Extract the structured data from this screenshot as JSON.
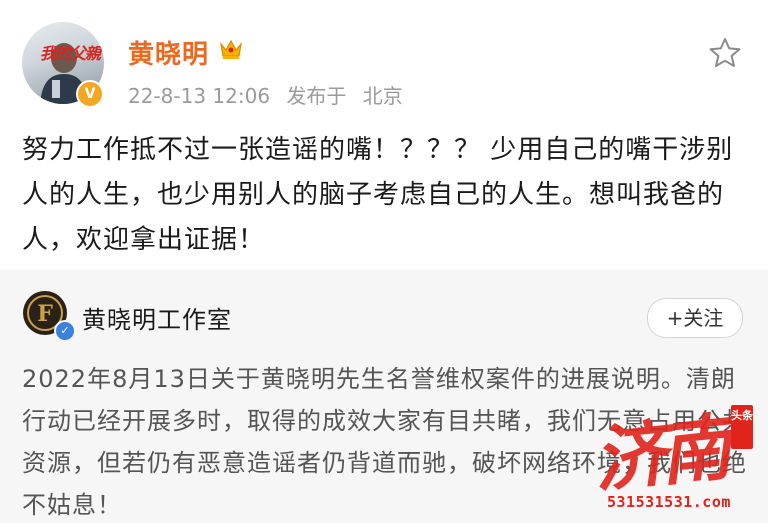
{
  "post": {
    "avatar_caption": "我的父親",
    "author_name": "黄晓明",
    "timestamp": "22-8-13 12:06",
    "location_prefix": "发布于",
    "location": "北京",
    "content": "努力工作抵不过一张造谣的嘴！？？？ 少用自己的嘴干涉别人的人生，也少用别人的脑子考虑自己的人生。想叫我爸的人，欢迎拿出证据！",
    "icons": {
      "verified": "verified-badge-icon",
      "crown": "crown-icon",
      "favorite": "star-icon"
    },
    "colors": {
      "author": "#ea6a1f",
      "meta": "#9a9a9a",
      "badge": "#f5a623"
    }
  },
  "repost": {
    "author_name": "黄晓明工作室",
    "follow_label": "+关注",
    "content": "2022年8月13日关于黄晓明先生名誉维权案件的进展说明。清朗行动已经开展多时，取得的成效大家有目共睹，我们无意占用公共资源，但若仍有恶意造谣者仍背道而驰，破坏网络环境，我们也绝不姑息！",
    "icons": {
      "avatar": "studio-logo-icon",
      "verified": "verified-badge-icon"
    },
    "colors": {
      "background": "#f6f6f6",
      "verified": "#3b82e0"
    }
  },
  "watermark": {
    "main_text": "济南",
    "tag_text": "头条",
    "url_text": "531531531.com",
    "color": "#e0241c"
  }
}
